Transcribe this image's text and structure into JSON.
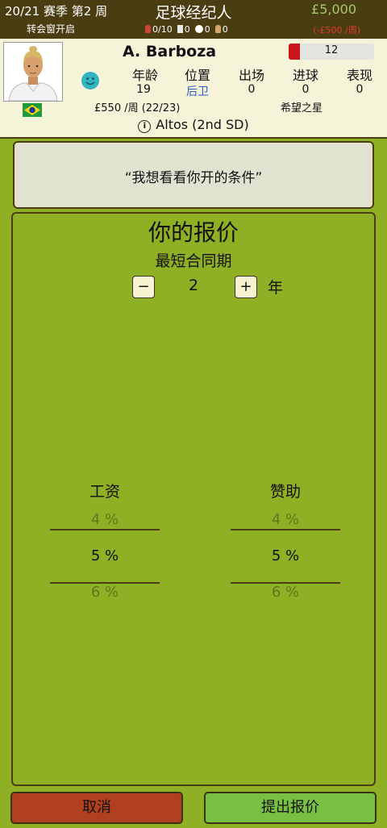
{
  "topbar": {
    "season": "20/21 赛季 第2 周",
    "transfer_window": "转会窗开启",
    "title": "足球经纪人",
    "money": "£5,000",
    "expense": "(-£500 /周)",
    "stats": {
      "clients": "0/10",
      "cards": "0",
      "scouts": "0",
      "staff": "0"
    }
  },
  "player": {
    "name": "A. Barboza",
    "nationality": "Brazil",
    "mood": "happy",
    "rating": 12,
    "rating_fraction": 0.13,
    "headers": {
      "age": "年龄",
      "position": "位置",
      "appearances": "出场",
      "goals": "进球",
      "performance": "表现"
    },
    "values": {
      "age": "19",
      "position": "后卫",
      "appearances": "0",
      "goals": "0",
      "performance": "0"
    },
    "wage": "£550 /周 (22/23)",
    "potential": "希望之星",
    "club": "Altos (2nd SD)"
  },
  "quote": "“我想看看你开的条件”",
  "offer": {
    "title": "你的报价",
    "contract_label": "最短合同期",
    "minus": "−",
    "plus": "+",
    "years": "2",
    "year_unit": "年",
    "wage": {
      "label": "工资",
      "above": "4 %",
      "selected": "5 %",
      "below": "6 %"
    },
    "sponsor": {
      "label": "赞助",
      "above": "4 %",
      "selected": "5 %",
      "below": "6 %"
    }
  },
  "buttons": {
    "cancel": "取消",
    "submit": "提出报价"
  },
  "colors": {
    "background": "#8fb024",
    "header": "#4b3d12",
    "cancel": "#b0401f",
    "submit": "#78c043",
    "money": "#a7c96a",
    "expense": "#e53a2c"
  }
}
